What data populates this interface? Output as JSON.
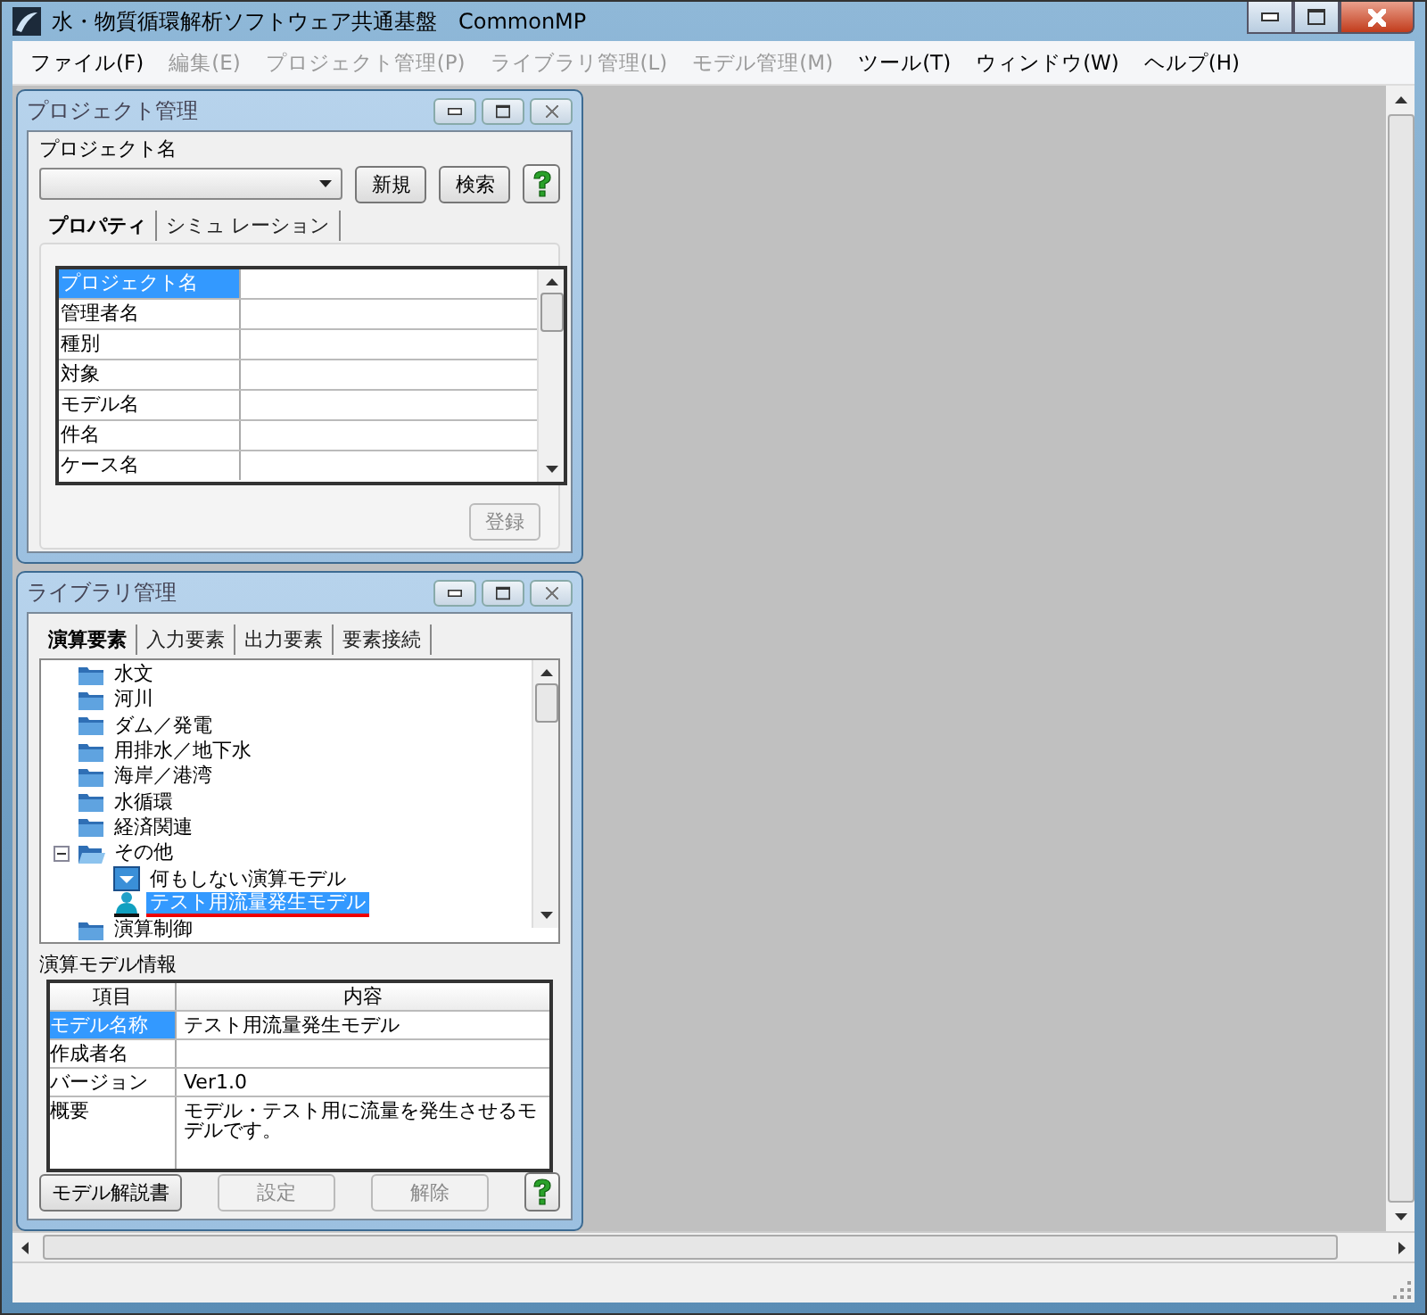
{
  "window": {
    "title": "水・物質循環解析ソフトウェア共通基盤　CommonMP"
  },
  "menu": [
    {
      "label": "ファイル(F)",
      "disabled": false
    },
    {
      "label": "編集(E)",
      "disabled": true
    },
    {
      "label": "プロジェクト管理(P)",
      "disabled": true
    },
    {
      "label": "ライブラリ管理(L)",
      "disabled": true
    },
    {
      "label": "モデル管理(M)",
      "disabled": true
    },
    {
      "label": "ツール(T)",
      "disabled": false
    },
    {
      "label": "ウィンドウ(W)",
      "disabled": false
    },
    {
      "label": "ヘルプ(H)",
      "disabled": false
    }
  ],
  "project_panel": {
    "title": "プロジェクト管理",
    "field_label": "プロジェクト名",
    "buttons": [
      {
        "label": "新規",
        "disabled": false
      },
      {
        "label": "検索",
        "disabled": false
      }
    ],
    "tabs": [
      {
        "label": "プロパティ",
        "selected": true
      },
      {
        "label": "シミュ レーション",
        "selected": false
      }
    ],
    "properties": [
      {
        "name": "プロジェクト名",
        "selected": true
      },
      {
        "name": "管理者名",
        "selected": false
      },
      {
        "name": "種別",
        "selected": false
      },
      {
        "name": "対象",
        "selected": false
      },
      {
        "name": "モデル名",
        "selected": false
      },
      {
        "name": "件名",
        "selected": false
      },
      {
        "name": "ケース名",
        "selected": false
      }
    ],
    "register_button": {
      "label": "登録",
      "disabled": true
    }
  },
  "library_panel": {
    "title": "ライブラリ管理",
    "tabs": [
      {
        "label": "演算要素",
        "selected": true
      },
      {
        "label": "入力要素",
        "selected": false
      },
      {
        "label": "出力要素",
        "selected": false
      },
      {
        "label": "要素接続",
        "selected": false
      }
    ],
    "tree": [
      {
        "label": "水文",
        "kind": "folder",
        "selected": false
      },
      {
        "label": "河川",
        "kind": "folder",
        "selected": false
      },
      {
        "label": "ダム／発電",
        "kind": "folder",
        "selected": false
      },
      {
        "label": "用排水／地下水",
        "kind": "folder",
        "selected": false
      },
      {
        "label": "海岸／港湾",
        "kind": "folder",
        "selected": false
      },
      {
        "label": "水循環",
        "kind": "folder",
        "selected": false
      },
      {
        "label": "経済関連",
        "kind": "folder",
        "selected": false
      },
      {
        "label": "その他",
        "kind": "folder",
        "expanded": true,
        "selected": false,
        "children": [
          {
            "label": "何もしない演算モデル",
            "kind": "model",
            "selected": false
          },
          {
            "label": "テスト用流量発生モデル",
            "kind": "person-model",
            "selected": true
          }
        ]
      },
      {
        "label": "演算制御",
        "kind": "folder",
        "selected": false
      }
    ],
    "info": {
      "title": "演算モデル情報",
      "columns": [
        "項目",
        "内容"
      ],
      "rows": [
        {
          "item": "モデル名称",
          "content": "テスト用流量発生モデル",
          "selected": true
        },
        {
          "item": "作成者名",
          "selected": false
        },
        {
          "item": "バージョン",
          "content": "Ver1.0",
          "selected": false
        },
        {
          "item": "概要",
          "content": "モデル・テスト用に流量を発生させるモデルです。",
          "selected": false
        }
      ]
    },
    "buttons": [
      {
        "label": "モデル解説書",
        "disabled": false
      },
      {
        "label": "設定",
        "disabled": true
      },
      {
        "label": "解除",
        "disabled": true
      }
    ]
  }
}
